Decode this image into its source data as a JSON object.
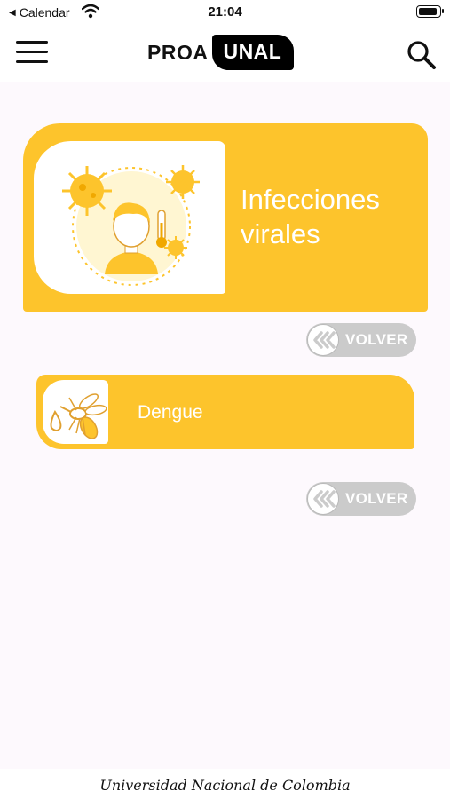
{
  "status_bar": {
    "back_label": "Calendar",
    "time": "21:04"
  },
  "header": {
    "logo_left": "PROA",
    "logo_right": "UNAL"
  },
  "icons": {
    "menu": "menu-icon",
    "search": "search-icon",
    "wifi": "wifi-icon",
    "battery": "battery-icon"
  },
  "banner": {
    "title": "Infecciones virales"
  },
  "topics": [
    {
      "label": "Dengue",
      "icon": "mosquito-icon"
    }
  ],
  "buttons": {
    "back_label": "VOLVER"
  },
  "footer": {
    "text": "Universidad Nacional de Colombia"
  },
  "colors": {
    "accent": "#fdc42c",
    "button_gray": "#cbcbcb",
    "background": "#fdf9fd"
  }
}
